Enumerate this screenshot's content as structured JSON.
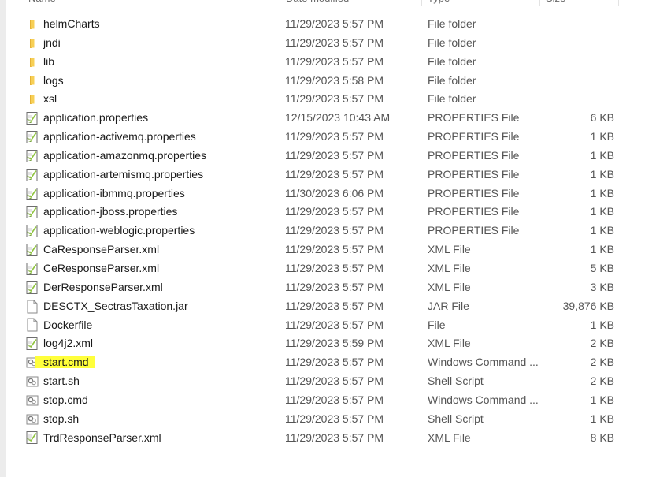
{
  "header": {
    "name": "Name",
    "date": "Date modified",
    "type": "Type",
    "size": "Size"
  },
  "files": [
    {
      "name": "helmCharts",
      "date": "11/29/2023 5:57 PM",
      "type": "File folder",
      "size": "",
      "icon": "folder-icon"
    },
    {
      "name": "jndi",
      "date": "11/29/2023 5:57 PM",
      "type": "File folder",
      "size": "",
      "icon": "folder-icon"
    },
    {
      "name": "lib",
      "date": "11/29/2023 5:57 PM",
      "type": "File folder",
      "size": "",
      "icon": "folder-icon"
    },
    {
      "name": "logs",
      "date": "11/29/2023 5:58 PM",
      "type": "File folder",
      "size": "",
      "icon": "folder-icon"
    },
    {
      "name": "xsl",
      "date": "11/29/2023 5:57 PM",
      "type": "File folder",
      "size": "",
      "icon": "folder-icon"
    },
    {
      "name": "application.properties",
      "date": "12/15/2023 10:43 AM",
      "type": "PROPERTIES File",
      "size": "6 KB",
      "icon": "notepadpp-file-icon"
    },
    {
      "name": "application-activemq.properties",
      "date": "11/29/2023 5:57 PM",
      "type": "PROPERTIES File",
      "size": "1 KB",
      "icon": "notepadpp-file-icon"
    },
    {
      "name": "application-amazonmq.properties",
      "date": "11/29/2023 5:57 PM",
      "type": "PROPERTIES File",
      "size": "1 KB",
      "icon": "notepadpp-file-icon"
    },
    {
      "name": "application-artemismq.properties",
      "date": "11/29/2023 5:57 PM",
      "type": "PROPERTIES File",
      "size": "1 KB",
      "icon": "notepadpp-file-icon"
    },
    {
      "name": "application-ibmmq.properties",
      "date": "11/30/2023 6:06 PM",
      "type": "PROPERTIES File",
      "size": "1 KB",
      "icon": "notepadpp-file-icon"
    },
    {
      "name": "application-jboss.properties",
      "date": "11/29/2023 5:57 PM",
      "type": "PROPERTIES File",
      "size": "1 KB",
      "icon": "notepadpp-file-icon"
    },
    {
      "name": "application-weblogic.properties",
      "date": "11/29/2023 5:57 PM",
      "type": "PROPERTIES File",
      "size": "1 KB",
      "icon": "notepadpp-file-icon"
    },
    {
      "name": "CaResponseParser.xml",
      "date": "11/29/2023 5:57 PM",
      "type": "XML File",
      "size": "1 KB",
      "icon": "notepadpp-file-icon"
    },
    {
      "name": "CeResponseParser.xml",
      "date": "11/29/2023 5:57 PM",
      "type": "XML File",
      "size": "5 KB",
      "icon": "notepadpp-file-icon"
    },
    {
      "name": "DerResponseParser.xml",
      "date": "11/29/2023 5:57 PM",
      "type": "XML File",
      "size": "3 KB",
      "icon": "notepadpp-file-icon"
    },
    {
      "name": "DESCTX_SectrasTaxation.jar",
      "date": "11/29/2023 5:57 PM",
      "type": "JAR File",
      "size": "39,876 KB",
      "icon": "blank-file-icon"
    },
    {
      "name": "Dockerfile",
      "date": "11/29/2023 5:57 PM",
      "type": "File",
      "size": "1 KB",
      "icon": "blank-file-icon"
    },
    {
      "name": "log4j2.xml",
      "date": "11/29/2023 5:59 PM",
      "type": "XML File",
      "size": "2 KB",
      "icon": "notepadpp-file-icon"
    },
    {
      "name": "start.cmd",
      "date": "11/29/2023 5:57 PM",
      "type": "Windows Command ...",
      "size": "2 KB",
      "icon": "script-file-icon",
      "highlight": "#ffff3b"
    },
    {
      "name": "start.sh",
      "date": "11/29/2023 5:57 PM",
      "type": "Shell Script",
      "size": "2 KB",
      "icon": "script-file-icon"
    },
    {
      "name": "stop.cmd",
      "date": "11/29/2023 5:57 PM",
      "type": "Windows Command ...",
      "size": "1 KB",
      "icon": "script-file-icon"
    },
    {
      "name": "stop.sh",
      "date": "11/29/2023 5:57 PM",
      "type": "Shell Script",
      "size": "1 KB",
      "icon": "script-file-icon"
    },
    {
      "name": "TrdResponseParser.xml",
      "date": "11/29/2023 5:57 PM",
      "type": "XML File",
      "size": "8 KB",
      "icon": "notepadpp-file-icon"
    }
  ],
  "colors": {
    "folder": "#f4c84a",
    "notepadpp_green": "#8fc43f",
    "highlight": "#ffff3b"
  }
}
